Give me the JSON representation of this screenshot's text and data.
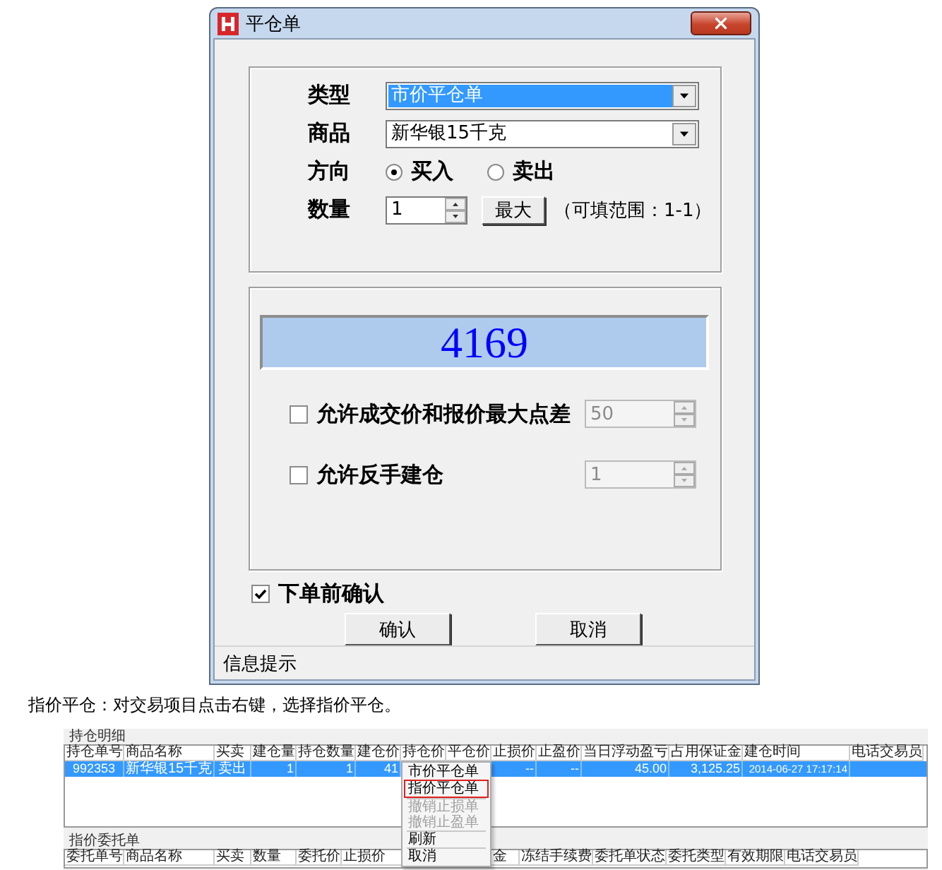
{
  "dialog": {
    "title": "平仓单",
    "form": [
      {
        "kind": "select",
        "label": "类型",
        "value": "市价平仓单",
        "focused": true
      },
      {
        "kind": "select",
        "label": "商品",
        "value": "新华银15千克",
        "focused": false
      },
      {
        "kind": "radio",
        "label": "方向",
        "options": [
          {
            "label": "买入",
            "selected": true
          },
          {
            "label": "卖出",
            "selected": false
          }
        ]
      },
      {
        "kind": "spin",
        "label": "数量",
        "value": "1",
        "button": "最大",
        "hint": "（可填范围：1-1）"
      }
    ],
    "price": "4169",
    "options": [
      {
        "label": "允许成交价和报价最大点差",
        "checked": false,
        "value": "50",
        "disabled": true
      },
      {
        "label": "允许反手建仓",
        "checked": false,
        "value": "1",
        "disabled": true
      }
    ],
    "confirm": {
      "label": "下单前确认",
      "checked": true
    },
    "buttons": [
      "确认",
      "取消"
    ],
    "status_bar": "信息提示"
  },
  "caption": "指价平仓：对交易项目点击右键，选择指价平仓。",
  "screenshot": {
    "positions": {
      "title": "持仓明细",
      "columns": [
        {
          "label": "持仓单号",
          "value": "992353"
        },
        {
          "label": "商品名称",
          "value": "新华银15千克"
        },
        {
          "label": "买卖",
          "value": "卖出"
        },
        {
          "label": "建仓量",
          "value": "1"
        },
        {
          "label": "持仓数量",
          "value": "1"
        },
        {
          "label": "建仓价",
          "value": "41"
        },
        {
          "label": "持仓价"
        },
        {
          "label": "平仓价"
        },
        {
          "label": "止损价",
          "value": "--"
        },
        {
          "label": "止盈价",
          "value": "--"
        },
        {
          "label": "当日浮动盈亏",
          "value": "45.00"
        },
        {
          "label": "占用保证金",
          "value": "3,125.25"
        },
        {
          "label": "建仓时间",
          "value": "2014-06-27 17:17:14"
        },
        {
          "label": "电话交易员"
        }
      ],
      "row_selected": true
    },
    "orders": {
      "title": "指价委托单",
      "columns": [
        "委托单号",
        "商品名称",
        "买卖",
        "数量",
        "委托价",
        "止损价",
        "金",
        "冻结手续费",
        "委托单状态",
        "委托类型",
        "有效期限",
        "电话交易员"
      ]
    },
    "context_menu": [
      {
        "label": "市价平仓单",
        "disabled": false,
        "highlighted": false,
        "separator_after": false
      },
      {
        "label": "指价平仓单",
        "disabled": false,
        "highlighted": true,
        "separator_after": true
      },
      {
        "label": "撤销止损单",
        "disabled": true,
        "highlighted": false,
        "separator_after": false
      },
      {
        "label": "撤销止盈单",
        "disabled": true,
        "highlighted": false,
        "separator_after": true
      },
      {
        "label": "刷新",
        "disabled": false,
        "highlighted": false,
        "separator_after": true
      },
      {
        "label": "取消",
        "disabled": false,
        "highlighted": false,
        "separator_after": false
      }
    ]
  }
}
